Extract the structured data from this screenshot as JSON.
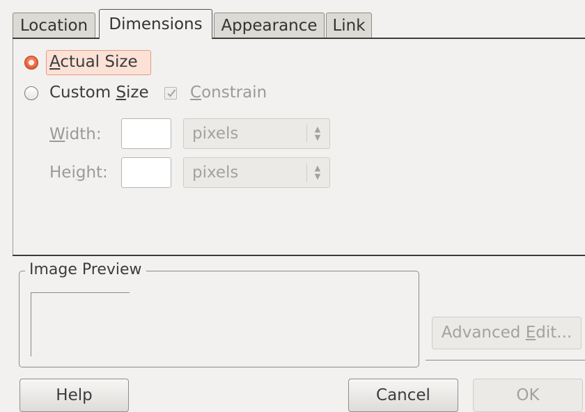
{
  "tabs": [
    {
      "label": "Location",
      "active": false
    },
    {
      "label": "Dimensions",
      "active": true
    },
    {
      "label": "Appearance",
      "active": false
    },
    {
      "label": "Link",
      "active": false
    }
  ],
  "size": {
    "actual_size_pre": "",
    "actual_size_mn": "A",
    "actual_size_post": "ctual Size",
    "actual_size_selected": true,
    "custom_size_pre": "Custom ",
    "custom_size_mn": "S",
    "custom_size_post": "ize",
    "custom_size_selected": false,
    "constrain_mn": "C",
    "constrain_post": "onstrain",
    "constrain_checked": true
  },
  "width": {
    "label_mn": "W",
    "label_post": "idth:",
    "value": "",
    "unit": "pixels"
  },
  "height": {
    "label_pre": "Hei",
    "label_mn": "g",
    "label_post": "ht:",
    "value": "",
    "unit": "pixels"
  },
  "preview": {
    "title": "Image Preview"
  },
  "buttons": {
    "advanced_pre": "Advanced ",
    "advanced_mn": "E",
    "advanced_post": "dit...",
    "help": "Help",
    "cancel": "Cancel",
    "ok": "OK"
  },
  "colors": {
    "radio_accent": "#e8643a",
    "focus_highlight": "#fbe1d6",
    "background": "#f2f1f0"
  }
}
